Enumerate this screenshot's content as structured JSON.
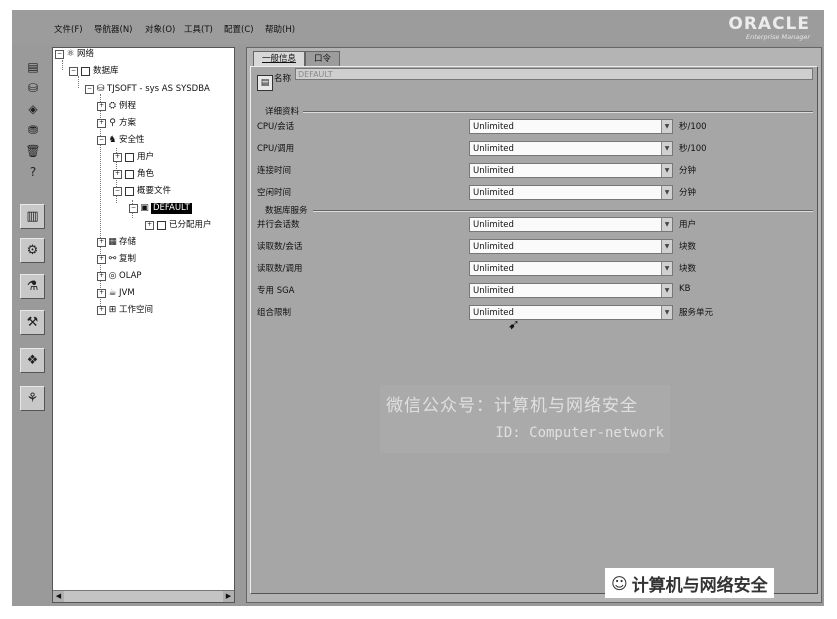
{
  "menu": {
    "items": [
      "文件(F)",
      "导航器(N)",
      "对象(O)",
      "工具(T)",
      "配置(C)",
      "帮助(H)"
    ]
  },
  "logo": {
    "line1": "ORACLE",
    "line2": "Enterprise Manager"
  },
  "toolbar": {
    "icons": [
      "cabinet-icon",
      "database-icon",
      "cube-icon",
      "server-group-icon",
      "trash-icon",
      "help-icon",
      "storage-icon",
      "security-icon",
      "instance-icon",
      "tools-icon",
      "schema-icon",
      "users-icon"
    ]
  },
  "tree": {
    "network": "网络",
    "databases": "数据库",
    "db_instance": "TJSOFT - sys AS SYSDBA",
    "routines": "例程",
    "schema": "方案",
    "security": "安全性",
    "users": "用户",
    "roles": "角色",
    "profiles": "概要文件",
    "default_profile": "DEFAULT",
    "assigned_users": "已分配用户",
    "storage": "存储",
    "replication": "复制",
    "olap": "OLAP",
    "jvm": "JVM",
    "workspace": "工作空间"
  },
  "tabs": {
    "general": "一般信息",
    "password": "口令"
  },
  "form": {
    "name_label": "名称",
    "name_value": "DEFAULT",
    "details_title": "详细资料",
    "db_service_title": "数据库服务",
    "rows": [
      {
        "label": "CPU/会话",
        "value": "Unlimited",
        "unit": "秒/100"
      },
      {
        "label": "CPU/调用",
        "value": "Unlimited",
        "unit": "秒/100"
      },
      {
        "label": "连接时间",
        "value": "Unlimited",
        "unit": "分钟"
      },
      {
        "label": "空闲时间",
        "value": "Unlimited",
        "unit": "分钟"
      },
      {
        "label": "并行会话数",
        "value": "Unlimited",
        "unit": "用户"
      },
      {
        "label": "读取数/会话",
        "value": "Unlimited",
        "unit": "块数"
      },
      {
        "label": "读取数/调用",
        "value": "Unlimited",
        "unit": "块数"
      },
      {
        "label": "专用 SGA",
        "value": "Unlimited",
        "unit": "KB"
      },
      {
        "label": "组合限制",
        "value": "Unlimited",
        "unit": "服务单元"
      }
    ]
  },
  "watermark": {
    "line1": "微信公众号：计算机与网络安全",
    "line2": "ID: Computer-network"
  },
  "brand": {
    "text": "计算机与网络安全"
  }
}
